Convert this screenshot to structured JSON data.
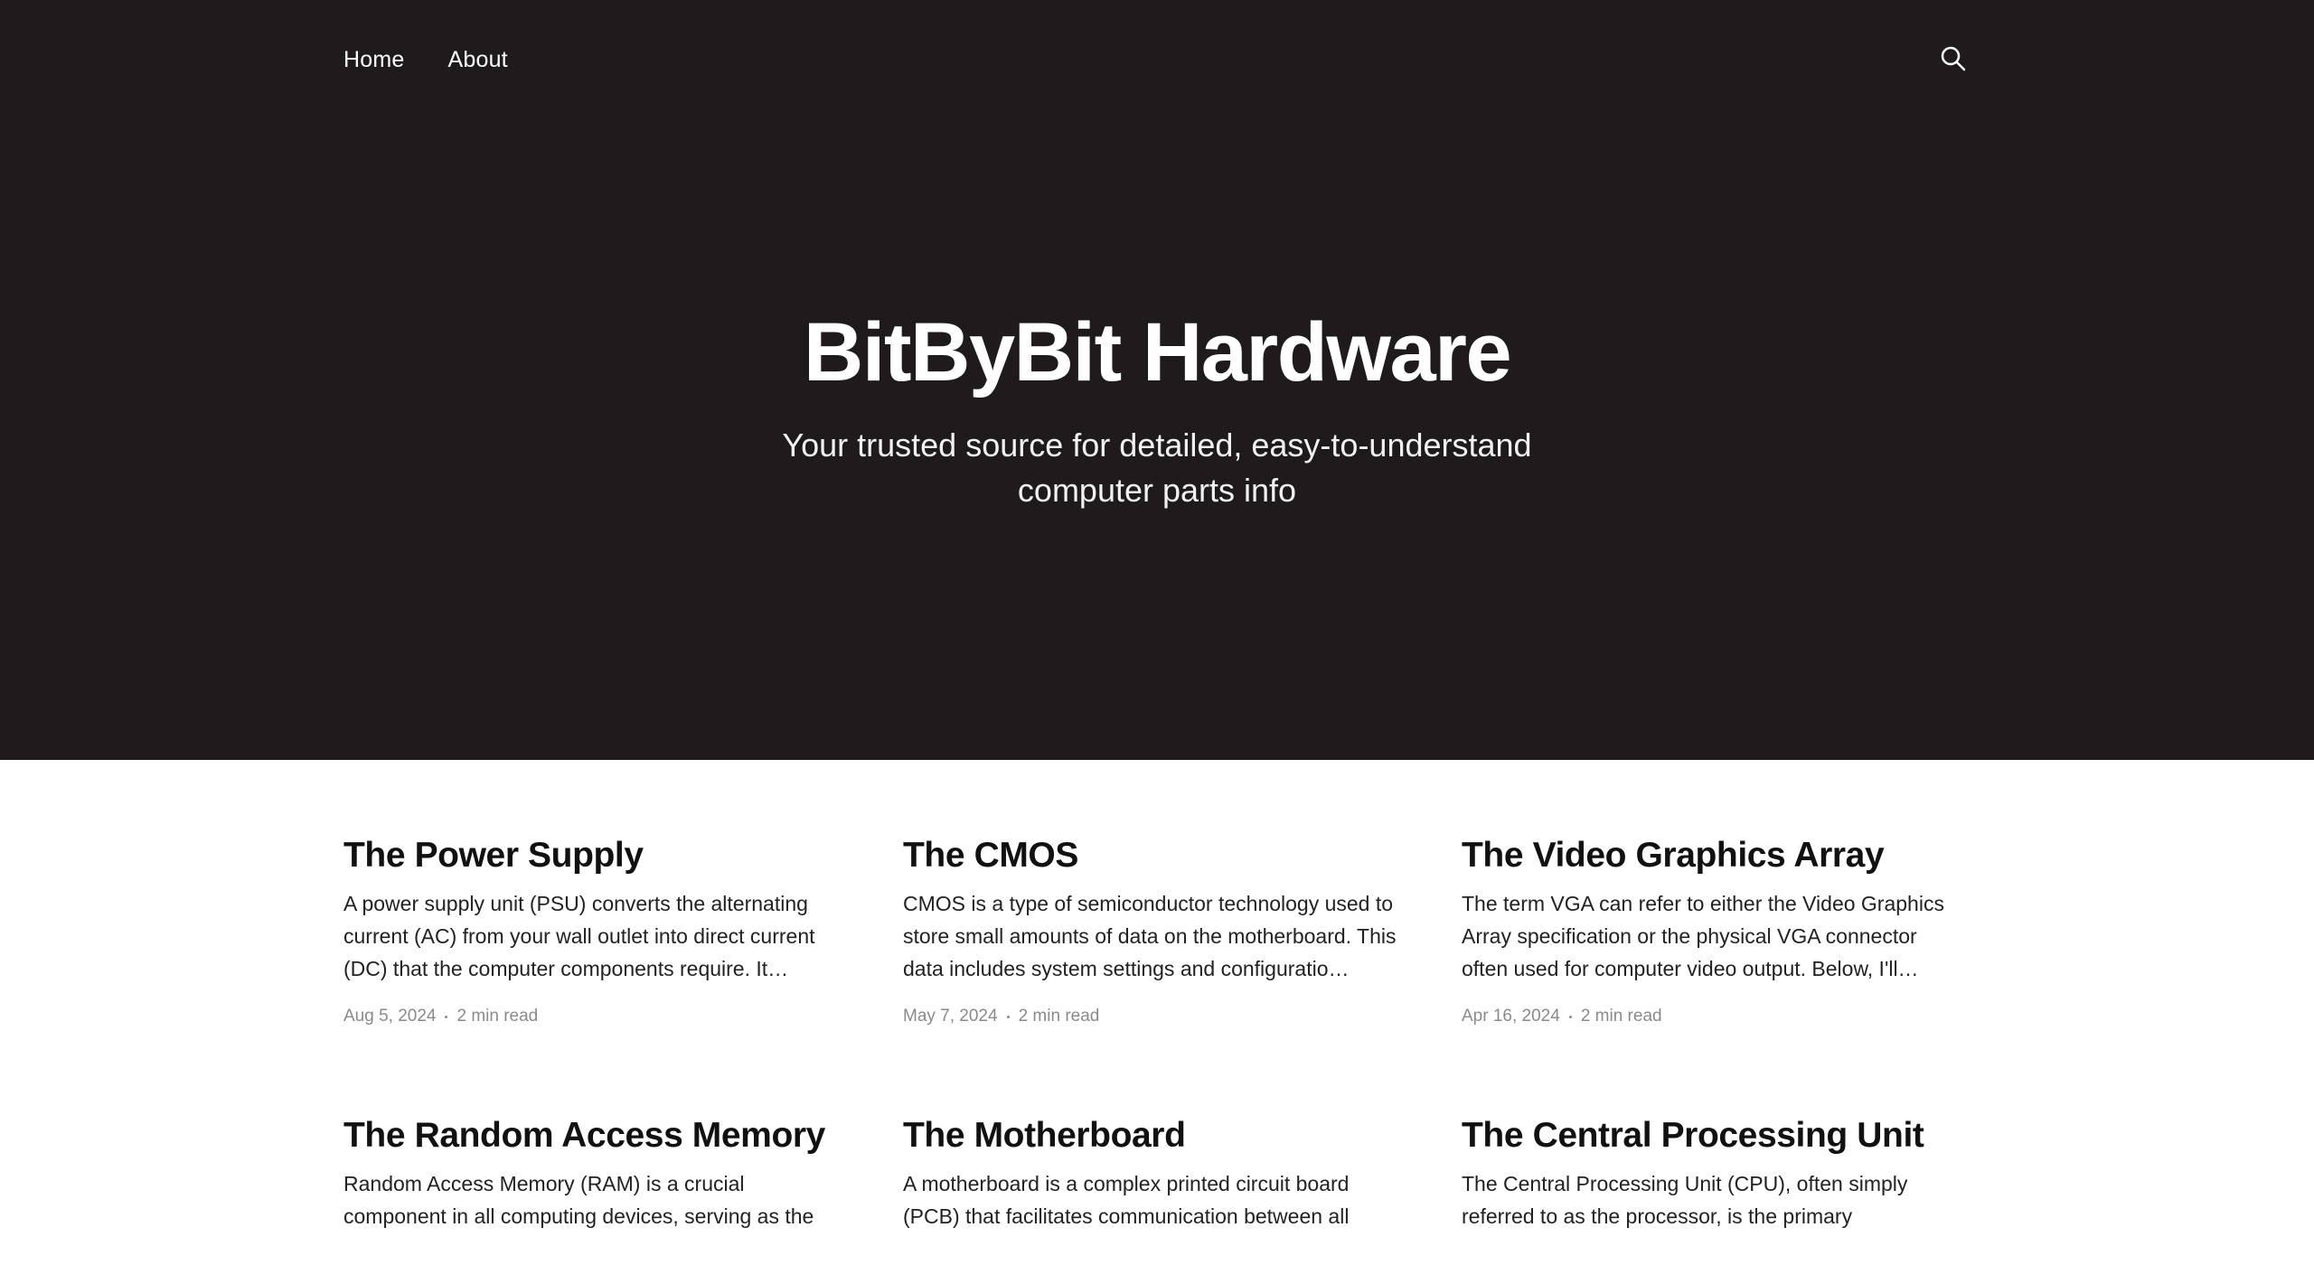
{
  "nav": {
    "items": [
      {
        "label": "Home"
      },
      {
        "label": "About"
      }
    ],
    "search_icon": "search-icon"
  },
  "hero": {
    "title": "BitByBit Hardware",
    "description": "Your trusted source for detailed, easy-to-understand computer parts info"
  },
  "posts": [
    {
      "title": "The Power Supply",
      "excerpt": "A power supply unit (PSU) converts the alternating current (AC) from your wall outlet into direct current (DC) that the computer components require. It…",
      "date": "Aug 5, 2024",
      "read_time": "2 min read"
    },
    {
      "title": "The CMOS",
      "excerpt": "CMOS is a type of semiconductor technology used to store small amounts of data on the motherboard. This data includes system settings and configuratio…",
      "date": "May 7, 2024",
      "read_time": "2 min read"
    },
    {
      "title": "The Video Graphics Array",
      "excerpt": "The term VGA can refer to either the Video Graphics Array specification or the physical VGA connector often used for computer video output. Below, I'll…",
      "date": "Apr 16, 2024",
      "read_time": "2 min read"
    },
    {
      "title": "The Random Access Memory",
      "excerpt": "Random Access Memory (RAM) is a crucial component in all computing devices, serving as the",
      "date": "",
      "read_time": ""
    },
    {
      "title": "The Motherboard",
      "excerpt": "A motherboard is a complex printed circuit board (PCB) that facilitates communication between all",
      "date": "",
      "read_time": ""
    },
    {
      "title": "The Central Processing Unit",
      "excerpt": "The Central Processing Unit (CPU), often simply referred to as the processor, is the primary",
      "date": "",
      "read_time": ""
    }
  ]
}
